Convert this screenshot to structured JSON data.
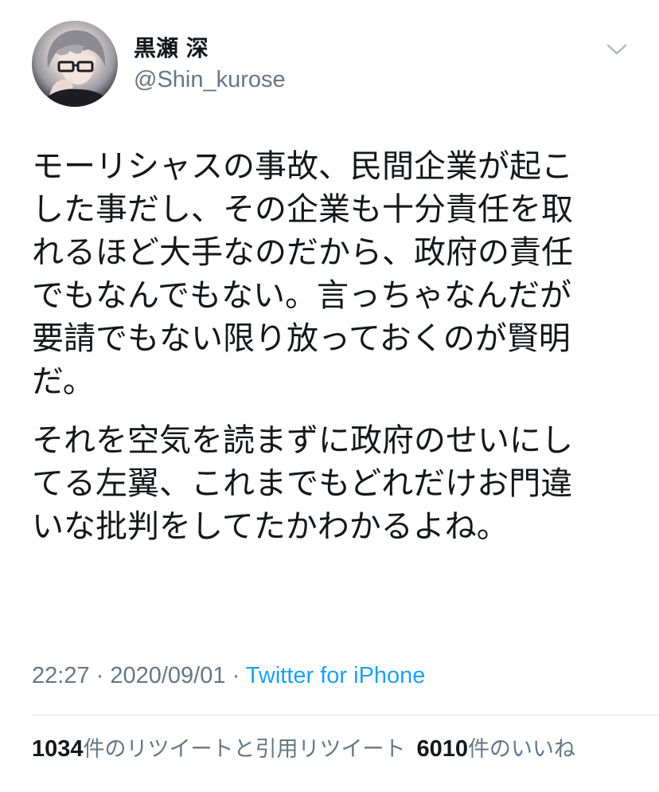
{
  "author": {
    "display_name": "黒瀬 深",
    "handle": "@Shin_kurose",
    "avatar_icon": "avatar-portrait-icon"
  },
  "menu": {
    "caret_icon": "chevron-down-icon"
  },
  "tweet": {
    "paragraphs": [
      {
        "lines": [
          "モーリシャスの事故、民間企業が起こ",
          "した事だし、その企業も十分責任を取",
          "れるほど大手なのだから、政府の責任",
          "でもなんでもない。言っちゃなんだが",
          "要請でもない限り放っておくのが賢明",
          "だ。"
        ]
      },
      {
        "lines": [
          "それを空気を読まずに政府のせいにし",
          "てる左翼、これまでもどれだけお門違",
          "いな批判をしてたかわかるよね。"
        ]
      }
    ]
  },
  "meta": {
    "time": "22:27",
    "separator": " · ",
    "date": "2020/09/01",
    "source": "Twitter for iPhone"
  },
  "stats": {
    "retweets_count": "1034",
    "retweets_label": "件のリツイートと引用リツイート",
    "likes_count": "6010",
    "likes_label": "件のいいね"
  },
  "colors": {
    "text": "#14171a",
    "secondary": "#657786",
    "link": "#1da1f2",
    "divider": "#dfe3e8"
  }
}
